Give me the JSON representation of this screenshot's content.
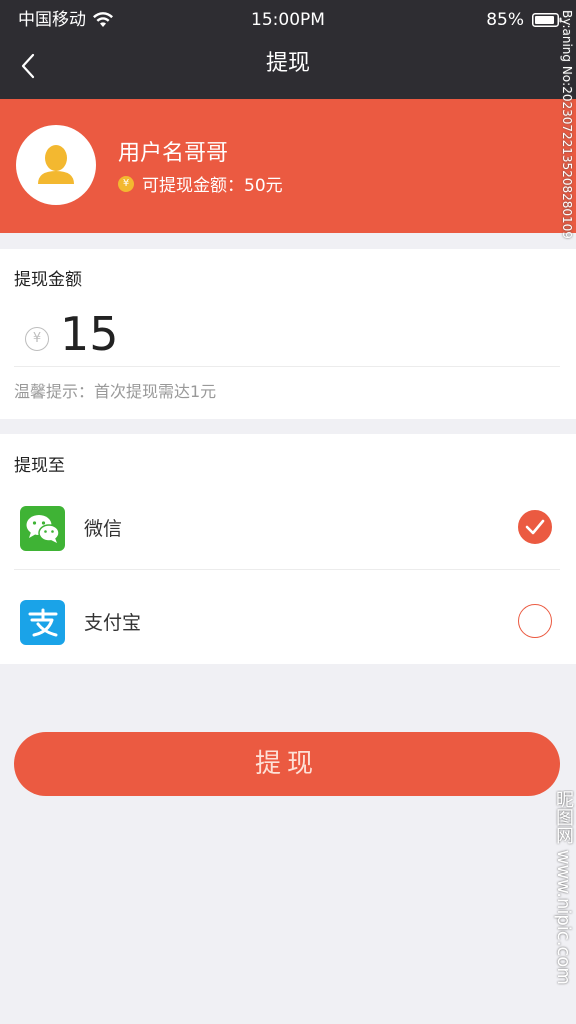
{
  "status_bar": {
    "carrier": "中国移动",
    "time": "15:00PM",
    "battery": "85%"
  },
  "nav": {
    "title": "提现",
    "back_icon": "chevron-left-icon"
  },
  "profile": {
    "username": "用户名哥哥",
    "balance_text": "可提现金额：50元",
    "coin_symbol": "¥"
  },
  "amount": {
    "label": "提现金额",
    "currency_symbol": "¥",
    "value": "15",
    "tip": "温馨提示：首次提现需达1元"
  },
  "withdraw_to": {
    "label": "提现至",
    "options": [
      {
        "label": "微信",
        "icon": "wechat-icon",
        "selected": true
      },
      {
        "label": "支付宝",
        "icon": "alipay-icon",
        "selected": false
      }
    ]
  },
  "submit": {
    "label": "提现"
  },
  "watermarks": {
    "right": "By:aning No:20230722135208280109",
    "bottom": "昵图网 www.nipic.com"
  },
  "colors": {
    "accent": "#eb5a41",
    "topbar": "#2e2d32",
    "wechat": "#3fb335",
    "alipay": "#1aa3e8",
    "coin": "#f3b830"
  }
}
